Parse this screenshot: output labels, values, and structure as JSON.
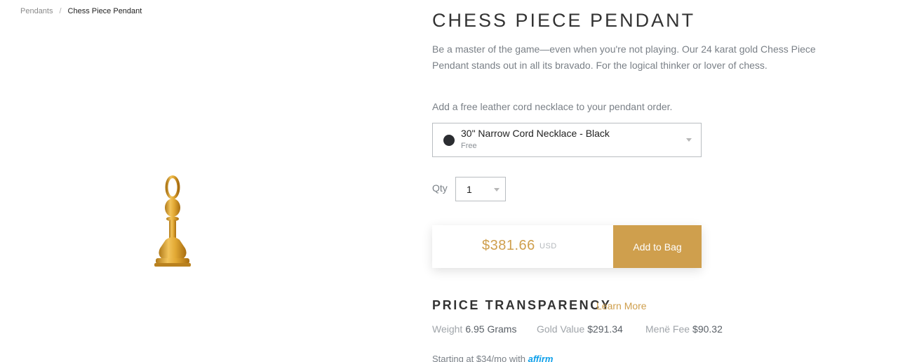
{
  "breadcrumb": {
    "parent": "Pendants",
    "separator": "/",
    "current": "Chess Piece Pendant"
  },
  "product": {
    "image_icon": "chess-pawn-pendant-icon",
    "title": "CHESS PIECE PENDANT",
    "description": "Be a master of the game—even when you're not playing. Our 24 karat gold Chess Piece Pendant stands out in all its bravado. For the logical thinker or lover of chess."
  },
  "cord": {
    "label": "Add a free leather cord necklace to your pendant order.",
    "selected_name": "30\" Narrow Cord Necklace - Black",
    "selected_sub": "Free",
    "swatch_color": "#2b2d31"
  },
  "qty": {
    "label": "Qty",
    "value": "1"
  },
  "buy": {
    "price": "$381.66",
    "currency": "USD",
    "add_label": "Add to Bag",
    "accent_color": "#cf9f4d"
  },
  "transparency": {
    "heading": "PRICE TRANSPARENCY",
    "link": "Learn More",
    "weight_label": "Weight",
    "weight_value": "6.95 Grams",
    "gold_label": "Gold Value",
    "gold_value": "$291.34",
    "fee_label": "Menë Fee",
    "fee_value": "$90.32"
  },
  "financing": {
    "text": "Starting at $34/mo with",
    "logo": "affirm"
  }
}
